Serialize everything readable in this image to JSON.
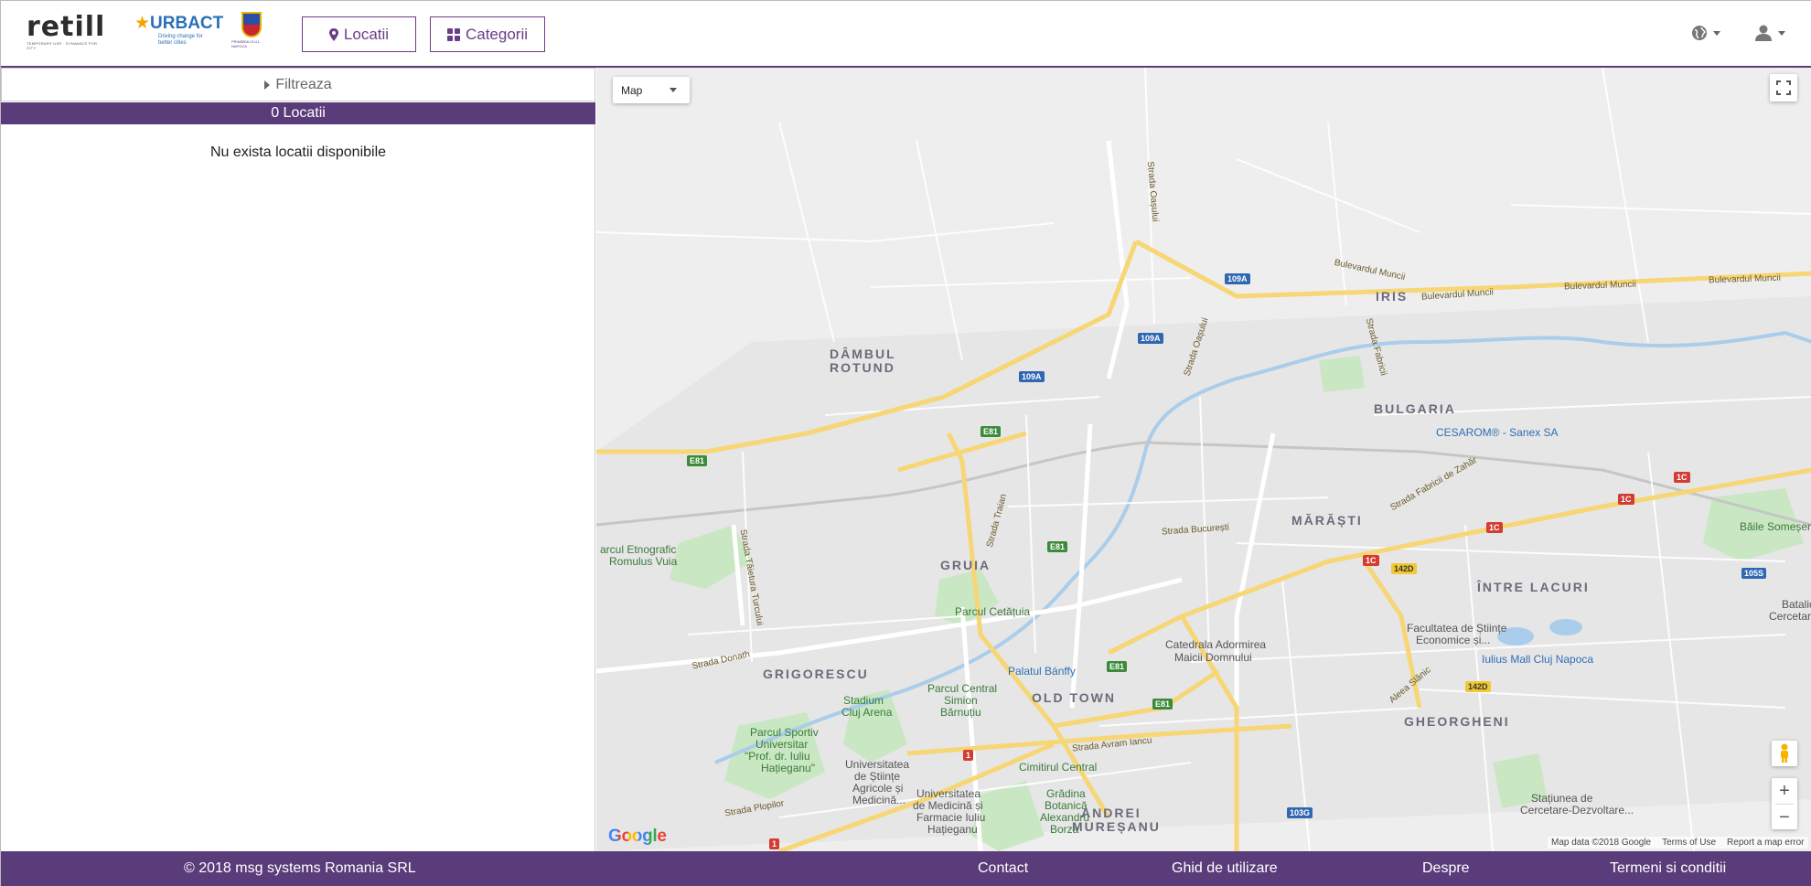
{
  "header": {
    "logos": {
      "retill": "retill",
      "retill_tagline": "TEMPORARY USE · DYNAMICS FOR CITY",
      "urbact": "URBACT",
      "urbact_tagline": "Driving change for better cities",
      "crest_caption": "PRIMĂRIA CLUJ-NAPOCA"
    },
    "nav": {
      "locatii_label": "Locatii",
      "categorii_label": "Categorii"
    },
    "icons": [
      "globe-icon",
      "user-icon"
    ]
  },
  "sidebar": {
    "filter_label": "Filtreaza",
    "count_label": "0 Locatii",
    "empty_message": "Nu exista locatii disponibile"
  },
  "map": {
    "type_selector": "Map",
    "districts": {
      "dambul1": "DÂMBUL",
      "dambul2": "ROTUND",
      "iris": "IRIS",
      "bulgaria": "BULGARIA",
      "marasti": "MĂRĂȘTI",
      "gruia": "GRUIA",
      "grigorescu": "GRIGORESCU",
      "oldtown": "OLD TOWN",
      "intrelacuri": "ÎNTRE LACURI",
      "gheorgheni": "GHEORGHENI",
      "andrei1": "ANDREI",
      "andrei2": "MUREȘANU"
    },
    "pois": {
      "cesarom": "CESAROM® - Sanex SA",
      "etno1": "arcul Etnografic",
      "etno2": "Romulus Vuia",
      "cetatuia": "Parcul Cetățuia",
      "catedrala1": "Catedrala Adormirea",
      "catedrala2": "Maicii Domnului",
      "banffy": "Palatul Bánffy",
      "stadium1": "Stadium",
      "stadium2": "Cluj Arena",
      "central1": "Parcul Central",
      "central2": "Simion",
      "central3": "Bărnuțiu",
      "sportiv1": "Parcul Sportiv",
      "sportiv2": "Universitar",
      "sportiv3": "\"Prof. dr. Iuliu",
      "sportiv4": "Hațieganu\"",
      "usamv1": "Universitatea",
      "usamv2": "de Științe",
      "usamv3": "Agricole și",
      "usamv4": "Medicină...",
      "umf1": "Universitatea",
      "umf2": "de Medicină și",
      "umf3": "Farmacie Iuliu",
      "umf4": "Hațieganu",
      "cimitir": "Cimitirul Central",
      "gradina1": "Grădina",
      "gradina2": "Botanică",
      "gradina3": "Alexandru",
      "gradina4": "Borza",
      "fse1": "Facultatea de Științe",
      "fse2": "Economice și...",
      "iulius": "Iulius Mall Cluj Napoca",
      "baile": "Băile Someșeni",
      "statiunea1": "Stațiunea de",
      "statiunea2": "Cercetare-Dezvoltare...",
      "batalion1": "Batalio",
      "batalion2": "Cercetare V"
    },
    "roads": {
      "muncii1": "Bulevardul Muncii",
      "muncii2": "Bulevardul Muncii",
      "muncii3": "Bulevardul Muncii",
      "muncii4": "Bulevardul Muncii",
      "oasului1": "Strada Oașului",
      "oasului2": "Strada Oașului",
      "fabricii": "Strada Fabricii",
      "fabricii_zahar": "Strada Fabricii de Zahăr",
      "bucuresti": "Strada București",
      "traian": "Strada Traian",
      "taietura": "Strada Tăietura Turcului",
      "donath": "Strada Donath",
      "avram": "Strada Avram Iancu",
      "slanic": "Aleea Slănic",
      "plopilor": "Strada Plopilor"
    },
    "shields": {
      "s109a1": "109A",
      "s109a2": "109A",
      "s109a3": "109A",
      "e81a": "E81",
      "e81b": "E81",
      "e81c": "E81",
      "e81d": "E81",
      "e81e": "E81",
      "c1a": "1C",
      "c1b": "1C",
      "c1c": "1C",
      "c1d": "1C",
      "d142a": "142D",
      "d142b": "142D",
      "s105": "105S",
      "s103": "103G",
      "one_a": "1",
      "one_b": "1"
    },
    "google_logo": "Google",
    "attribution": {
      "data": "Map data ©2018 Google",
      "terms": "Terms of Use",
      "report": "Report a map error"
    }
  },
  "footer": {
    "copyright": "© 2018 msg systems Romania SRL",
    "contact": "Contact",
    "ghid": "Ghid de utilizare",
    "despre": "Despre",
    "termeni": "Termeni si conditii"
  },
  "colors": {
    "brand_purple": "#5b3c7a",
    "nav_border": "#6a3c8a"
  }
}
